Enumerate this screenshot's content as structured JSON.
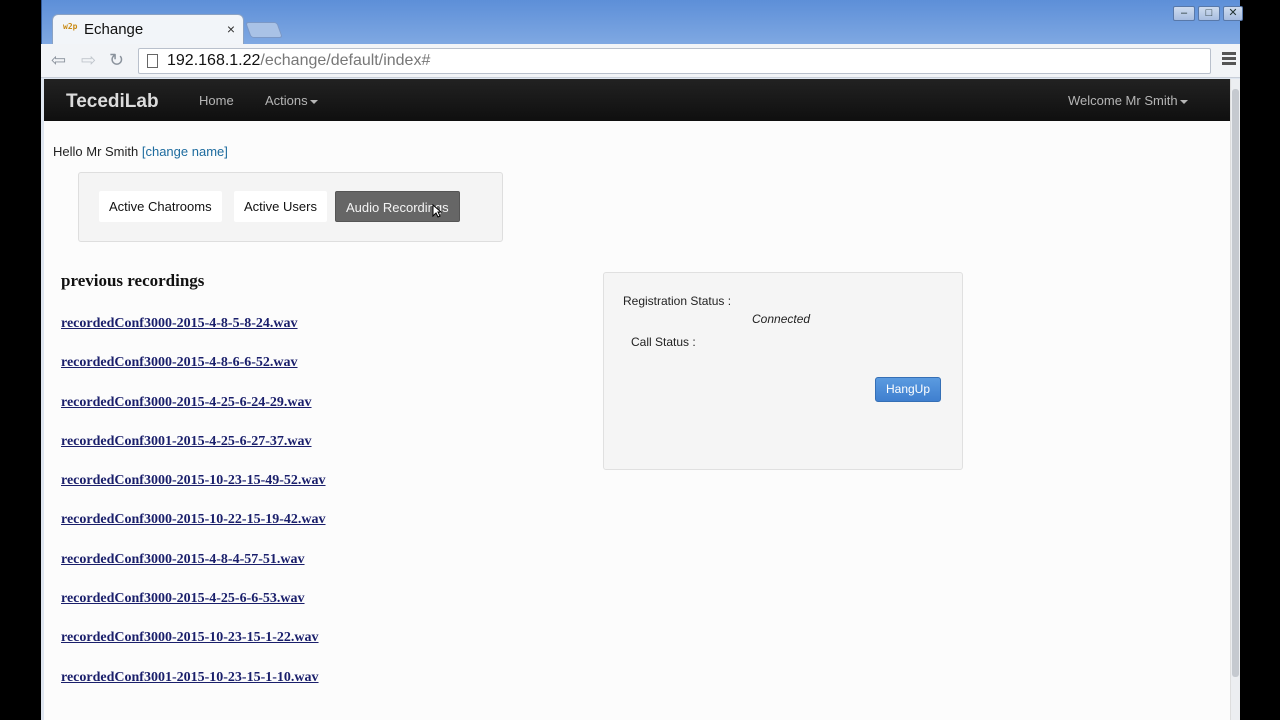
{
  "browser": {
    "tab_title": "Echange",
    "tab_favicon": "w2p",
    "tab_close": "×",
    "url_host": "192.168.1.22",
    "url_path": "/echange/default/index#",
    "icons": {
      "back": "back-arrow-icon",
      "forward": "forward-arrow-icon",
      "reload": "reload-icon",
      "star": "bookmark-star-icon",
      "menu": "menu-icon"
    }
  },
  "window_controls": {
    "minimize": "–",
    "maximize": "□",
    "close": "✕"
  },
  "navbar": {
    "brand": "TecediLab",
    "home": "Home",
    "actions": "Actions",
    "user_menu": "Welcome Mr Smith"
  },
  "greeting": {
    "text": "Hello Mr Smith ",
    "change_link": "[change name]"
  },
  "tabs": [
    {
      "label": "Active Chatrooms"
    },
    {
      "label": "Active Users"
    },
    {
      "label": "Audio Recordings",
      "active": true
    }
  ],
  "recordings": {
    "heading": "previous recordings",
    "items": [
      "recordedConf3000-2015-4-8-5-8-24.wav",
      "recordedConf3000-2015-4-8-6-6-52.wav",
      "recordedConf3000-2015-4-25-6-24-29.wav",
      "recordedConf3001-2015-4-25-6-27-37.wav",
      "recordedConf3000-2015-10-23-15-49-52.wav",
      "recordedConf3000-2015-10-22-15-19-42.wav",
      "recordedConf3000-2015-4-8-4-57-51.wav",
      "recordedConf3000-2015-4-25-6-6-53.wav",
      "recordedConf3000-2015-10-23-15-1-22.wav",
      "recordedConf3001-2015-10-23-15-1-10.wav"
    ]
  },
  "status": {
    "registration_label": "Registration Status :",
    "registration_value": "Connected",
    "call_label": "Call Status :",
    "hangup_label": "HangUp"
  },
  "colors": {
    "navbar_bg": "#111111",
    "active_tab": "#666666",
    "link": "#1a1f6b",
    "hangup_button": "#4a8cd8"
  }
}
